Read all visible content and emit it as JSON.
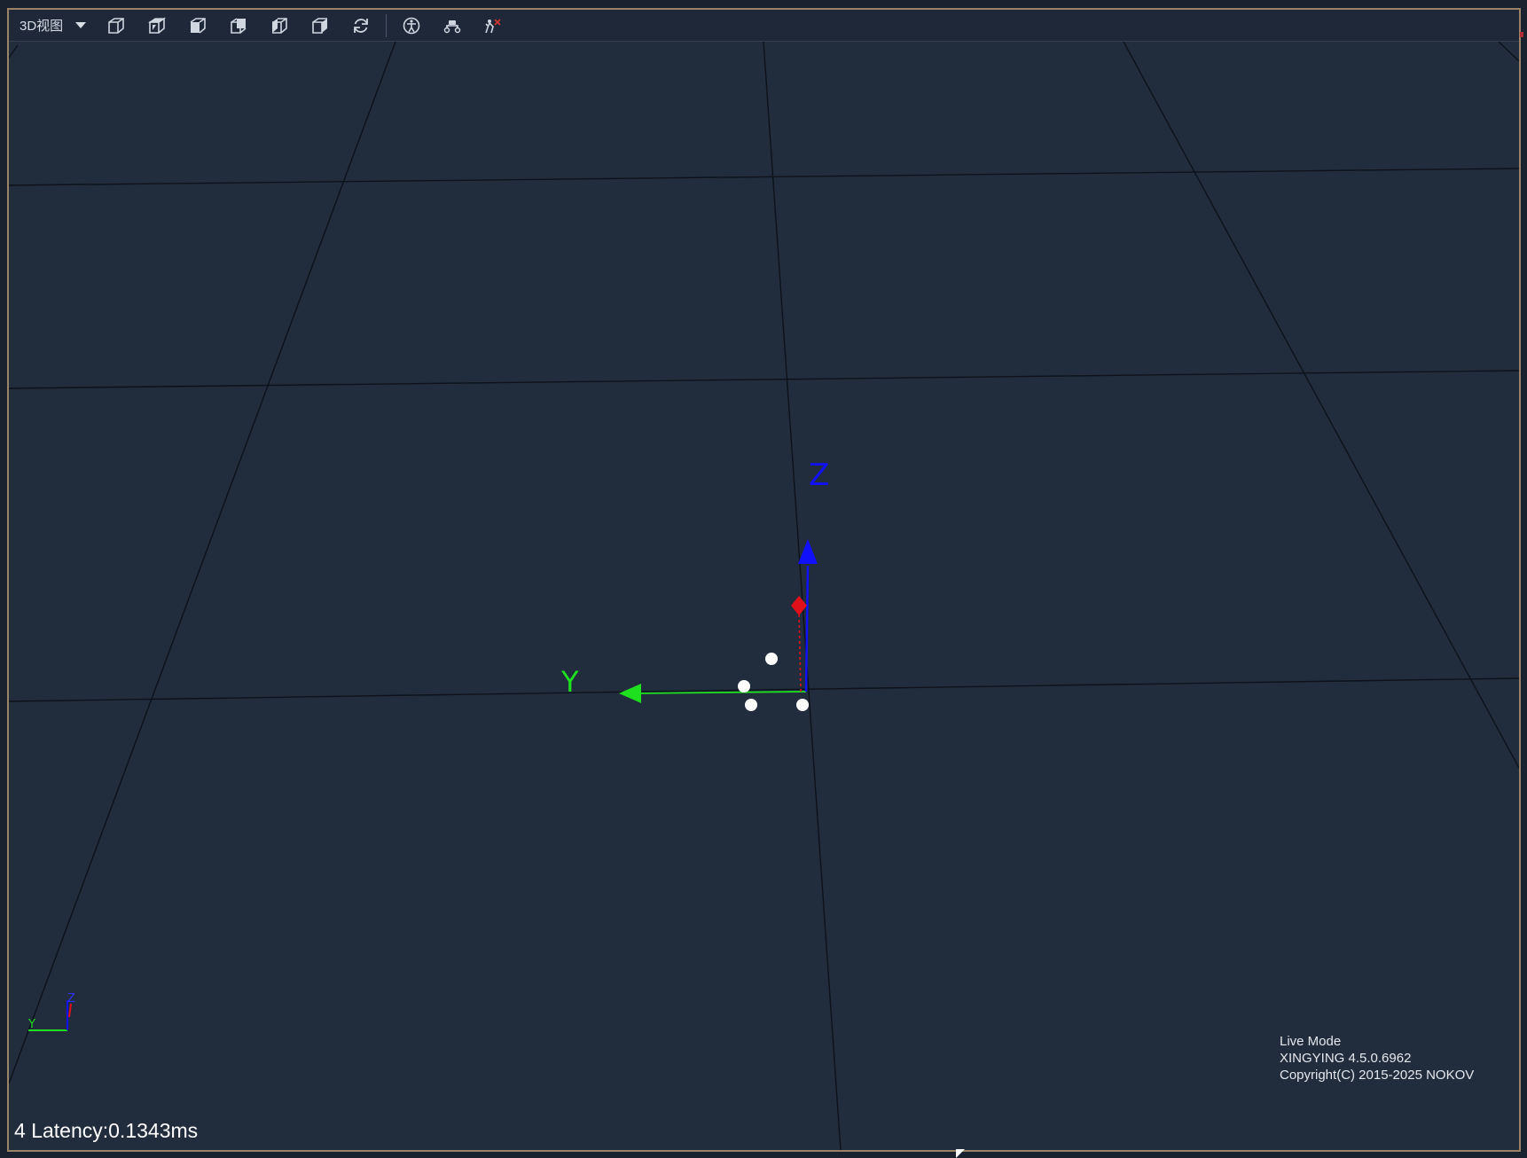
{
  "toolbar": {
    "view_mode": "3D视图",
    "buttons": [
      {
        "name": "perspective-view-button",
        "icon": "cube-perspective-icon"
      },
      {
        "name": "top-view-button",
        "icon": "cube-top-icon"
      },
      {
        "name": "front-view-button",
        "icon": "cube-front-icon"
      },
      {
        "name": "back-view-button",
        "icon": "cube-back-icon"
      },
      {
        "name": "left-view-button",
        "icon": "cube-left-icon"
      },
      {
        "name": "right-view-button",
        "icon": "cube-right-icon"
      },
      {
        "name": "reset-view-button",
        "icon": "refresh-icon"
      },
      {
        "name": "skeleton-button",
        "icon": "skeleton-icon"
      },
      {
        "name": "drone-button",
        "icon": "drone-icon"
      },
      {
        "name": "marker-button",
        "icon": "marker-icon"
      }
    ]
  },
  "scene": {
    "axis_labels": {
      "z": "Z",
      "y": "Y"
    },
    "mini_axis_labels": {
      "y": "Y",
      "z": "Z"
    },
    "colors": {
      "background": "#212c3d",
      "grid_line": "#0d121a",
      "x_axis": "#e0101a",
      "y_axis": "#1fe01f",
      "z_axis": "#1010ff",
      "marker": "#ffffff"
    },
    "marker_count": 4
  },
  "status": {
    "marker_count": "4",
    "latency": "Latency:0.1343ms"
  },
  "info": {
    "mode": "Live Mode",
    "version": "XINGYING 4.5.0.6962",
    "copyright": "Copyright(C) 2015-2025 NOKOV"
  }
}
